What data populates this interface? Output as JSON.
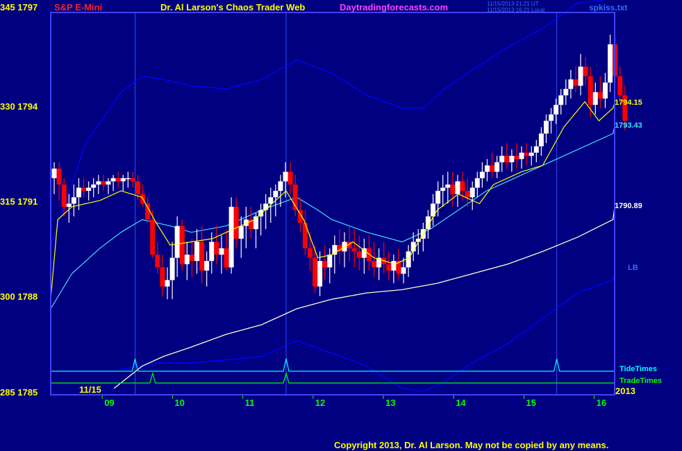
{
  "header": {
    "symbol": "S&P E-Mini",
    "title": "Dr. Al Larson's Chaos Trader Web",
    "site": "Daytradingforecasts.com",
    "timestamp_utc": "11/15/2013 21:21 UT",
    "timestamp_local": "11/15/2013 16:21 Local",
    "file": "spkiss.txt"
  },
  "footer": {
    "copyright": "Copyright 2013, Dr. Al Larson. May not be copied by any means."
  },
  "date_label": "11/15",
  "year_label": "2013",
  "colors": {
    "background": "#000080",
    "frame": "#4040ff",
    "up_bar": "#ffffff",
    "down_bar": "#ff0000",
    "fast_ma": "#ffff00",
    "mid_ma": "#40e0ff",
    "slow_ma": "#ffffd0",
    "band": "#0000ff",
    "tide": "#00ffff",
    "trade": "#00ff00",
    "axis_text": "#ffff00",
    "day_text": "#00ff00"
  },
  "chart_data": {
    "type": "ohlc",
    "left_axis": {
      "labels": [
        "345 1797",
        "330 1794",
        "315 1791",
        "300 1788",
        "285 1785"
      ],
      "values": [
        1797,
        1794,
        1791,
        1788,
        1785
      ],
      "range": [
        1785,
        1797
      ]
    },
    "x_axis": {
      "day_labels": [
        "09",
        "10",
        "11",
        "12",
        "13",
        "14",
        "15",
        "16"
      ]
    },
    "value_labels": [
      {
        "text": "1794.15",
        "series": "fast_ma",
        "value": 1794.15
      },
      {
        "text": "1793.43",
        "series": "mid_ma",
        "value": 1793.43
      },
      {
        "text": "1790.89",
        "series": "slow_ma",
        "value": 1790.89
      },
      {
        "text": "LB",
        "series": "lower_band",
        "value": 1788.8
      }
    ],
    "timing_lines": [
      {
        "name": "TideTimes",
        "peaks_day": [
          9.2,
          11.35,
          15.2
        ]
      },
      {
        "name": "TradeTimes",
        "peaks_day": [
          9.45,
          11.35
        ]
      }
    ],
    "vertical_markers_day": [
      9.2,
      11.35,
      15.2
    ],
    "series": {
      "upper_band": [
        [
          8.0,
          1789.7
        ],
        [
          8.5,
          1792.9
        ],
        [
          9.0,
          1794.5
        ],
        [
          9.3,
          1795.0
        ],
        [
          9.6,
          1794.9
        ],
        [
          10.0,
          1794.7
        ],
        [
          10.5,
          1794.6
        ],
        [
          11.0,
          1794.9
        ],
        [
          11.5,
          1795.5
        ],
        [
          12.0,
          1795.1
        ],
        [
          12.5,
          1794.4
        ],
        [
          13.0,
          1794.0
        ],
        [
          13.3,
          1794.0
        ],
        [
          13.6,
          1794.6
        ],
        [
          14.0,
          1795.2
        ],
        [
          14.5,
          1795.9
        ],
        [
          15.0,
          1796.5
        ],
        [
          15.5,
          1797.3
        ],
        [
          16.0,
          1798.2
        ]
      ],
      "lower_band": [
        [
          9.0,
          1785.8
        ],
        [
          9.5,
          1786.0
        ],
        [
          10.0,
          1786.0
        ],
        [
          10.5,
          1786.1
        ],
        [
          11.0,
          1786.2
        ],
        [
          11.5,
          1786.7
        ],
        [
          12.0,
          1786.3
        ],
        [
          12.5,
          1785.9
        ],
        [
          13.0,
          1785.2
        ],
        [
          13.3,
          1785.1
        ],
        [
          13.6,
          1785.4
        ],
        [
          14.0,
          1786.0
        ],
        [
          14.5,
          1786.6
        ],
        [
          15.0,
          1787.4
        ],
        [
          15.5,
          1788.2
        ],
        [
          16.0,
          1788.6
        ],
        [
          16.2,
          1788.8
        ]
      ],
      "slow_ma": [
        [
          8.9,
          1785.2
        ],
        [
          9.3,
          1785.9
        ],
        [
          9.6,
          1786.2
        ],
        [
          10.0,
          1786.5
        ],
        [
          10.5,
          1786.9
        ],
        [
          11.0,
          1787.2
        ],
        [
          11.5,
          1787.7
        ],
        [
          12.0,
          1788.0
        ],
        [
          12.5,
          1788.2
        ],
        [
          13.0,
          1788.3
        ],
        [
          13.5,
          1788.5
        ],
        [
          14.0,
          1788.8
        ],
        [
          14.5,
          1789.1
        ],
        [
          15.0,
          1789.5
        ],
        [
          15.5,
          1789.95
        ],
        [
          16.0,
          1790.5
        ],
        [
          16.2,
          1790.89
        ]
      ],
      "mid_ma": [
        [
          8.0,
          1787.7
        ],
        [
          8.3,
          1788.8
        ],
        [
          8.7,
          1789.6
        ],
        [
          9.0,
          1790.1
        ],
        [
          9.3,
          1790.5
        ],
        [
          9.7,
          1790.3
        ],
        [
          10.0,
          1790.1
        ],
        [
          10.5,
          1790.3
        ],
        [
          11.0,
          1790.8
        ],
        [
          11.5,
          1791.2
        ],
        [
          11.8,
          1790.8
        ],
        [
          12.0,
          1790.5
        ],
        [
          12.5,
          1790.1
        ],
        [
          13.0,
          1789.8
        ],
        [
          13.4,
          1790.2
        ],
        [
          13.8,
          1790.8
        ],
        [
          14.2,
          1791.4
        ],
        [
          14.6,
          1791.8
        ],
        [
          15.0,
          1792.2
        ],
        [
          15.5,
          1792.7
        ],
        [
          16.0,
          1793.2
        ],
        [
          16.2,
          1793.43
        ]
      ],
      "fast_ma": [
        [
          8.0,
          1788.0
        ],
        [
          8.1,
          1790.5
        ],
        [
          8.3,
          1790.9
        ],
        [
          8.7,
          1791.1
        ],
        [
          9.0,
          1791.4
        ],
        [
          9.3,
          1791.2
        ],
        [
          9.5,
          1790.4
        ],
        [
          9.7,
          1789.7
        ],
        [
          10.0,
          1789.8
        ],
        [
          10.3,
          1789.9
        ],
        [
          10.6,
          1790.2
        ],
        [
          10.9,
          1790.5
        ],
        [
          11.1,
          1790.9
        ],
        [
          11.35,
          1791.4
        ],
        [
          11.6,
          1790.5
        ],
        [
          11.8,
          1789.3
        ],
        [
          12.0,
          1789.4
        ],
        [
          12.3,
          1789.8
        ],
        [
          12.6,
          1789.3
        ],
        [
          12.9,
          1789.1
        ],
        [
          13.1,
          1789.3
        ],
        [
          13.5,
          1790.8
        ],
        [
          13.8,
          1791.3
        ],
        [
          14.1,
          1791.0
        ],
        [
          14.3,
          1791.6
        ],
        [
          14.7,
          1792.0
        ],
        [
          15.0,
          1792.2
        ],
        [
          15.3,
          1793.4
        ],
        [
          15.6,
          1794.2
        ],
        [
          15.8,
          1793.6
        ],
        [
          16.0,
          1794.0
        ],
        [
          16.2,
          1794.15
        ]
      ]
    },
    "bars": [
      [
        8.05,
        1791.8,
        1792.3,
        1791.3,
        1792.1
      ],
      [
        8.12,
        1792.1,
        1792.3,
        1791.1,
        1791.6
      ],
      [
        8.19,
        1791.6,
        1791.8,
        1790.6,
        1790.9
      ],
      [
        8.26,
        1790.9,
        1791.3,
        1790.4,
        1791.0
      ],
      [
        8.33,
        1791.0,
        1791.6,
        1790.6,
        1791.2
      ],
      [
        8.4,
        1791.2,
        1791.8,
        1790.8,
        1791.5
      ],
      [
        8.47,
        1791.5,
        1791.8,
        1791.2,
        1791.4
      ],
      [
        8.54,
        1791.4,
        1791.7,
        1791.1,
        1791.5
      ],
      [
        8.61,
        1791.5,
        1791.8,
        1791.2,
        1791.6
      ],
      [
        8.68,
        1791.6,
        1791.9,
        1791.3,
        1791.7
      ],
      [
        8.75,
        1791.7,
        1791.9,
        1791.4,
        1791.6
      ],
      [
        8.82,
        1791.6,
        1791.8,
        1791.3,
        1791.7
      ],
      [
        8.89,
        1791.7,
        1791.9,
        1791.4,
        1791.8
      ],
      [
        8.96,
        1791.8,
        1792.0,
        1791.5,
        1791.7
      ],
      [
        9.03,
        1791.7,
        1791.9,
        1791.4,
        1791.8
      ],
      [
        9.1,
        1791.8,
        1792.0,
        1791.5,
        1791.8
      ],
      [
        9.17,
        1791.8,
        1792.0,
        1791.5,
        1791.7
      ],
      [
        9.24,
        1791.7,
        1791.9,
        1791.1,
        1791.3
      ],
      [
        9.31,
        1791.3,
        1791.6,
        1790.9,
        1791.0
      ],
      [
        9.38,
        1791.0,
        1791.2,
        1790.4,
        1790.5
      ],
      [
        9.45,
        1790.5,
        1790.8,
        1789.3,
        1789.4
      ],
      [
        9.52,
        1789.4,
        1789.8,
        1788.8,
        1789.0
      ],
      [
        9.59,
        1789.0,
        1789.4,
        1788.1,
        1788.4
      ],
      [
        9.66,
        1788.4,
        1789.0,
        1788.0,
        1788.6
      ],
      [
        9.73,
        1788.6,
        1789.8,
        1788.0,
        1789.3
      ],
      [
        9.8,
        1789.3,
        1790.6,
        1788.7,
        1790.3
      ],
      [
        9.87,
        1790.3,
        1790.5,
        1788.9,
        1789.1
      ],
      [
        9.94,
        1789.1,
        1789.8,
        1788.6,
        1789.4
      ],
      [
        10.01,
        1789.4,
        1789.9,
        1788.7,
        1789.2
      ],
      [
        10.08,
        1789.2,
        1790.2,
        1788.8,
        1789.8
      ],
      [
        10.15,
        1789.8,
        1790.3,
        1788.5,
        1788.9
      ],
      [
        10.22,
        1788.9,
        1789.5,
        1788.4,
        1789.2
      ],
      [
        10.29,
        1789.2,
        1790.1,
        1788.8,
        1789.8
      ],
      [
        10.36,
        1789.8,
        1790.3,
        1789.1,
        1789.4
      ],
      [
        10.43,
        1789.4,
        1790.0,
        1788.8,
        1789.6
      ],
      [
        10.5,
        1789.6,
        1790.2,
        1788.9,
        1789.0
      ],
      [
        10.57,
        1789.0,
        1791.2,
        1788.8,
        1790.9
      ],
      [
        10.64,
        1790.9,
        1791.2,
        1789.6,
        1789.9
      ],
      [
        10.71,
        1789.9,
        1790.6,
        1789.3,
        1790.3
      ],
      [
        10.78,
        1790.3,
        1790.9,
        1789.6,
        1790.5
      ],
      [
        10.85,
        1790.5,
        1790.9,
        1789.9,
        1790.2
      ],
      [
        10.92,
        1790.2,
        1790.7,
        1789.6,
        1790.6
      ],
      [
        10.99,
        1790.6,
        1791.0,
        1790.0,
        1790.8
      ],
      [
        11.06,
        1790.8,
        1791.3,
        1790.2,
        1791.0
      ],
      [
        11.13,
        1791.0,
        1791.5,
        1790.4,
        1791.2
      ],
      [
        11.2,
        1791.2,
        1791.6,
        1790.6,
        1791.4
      ],
      [
        11.27,
        1791.4,
        1791.9,
        1790.9,
        1791.7
      ],
      [
        11.34,
        1791.7,
        1792.3,
        1791.2,
        1792.0
      ],
      [
        11.41,
        1792.0,
        1792.3,
        1791.3,
        1791.6
      ],
      [
        11.48,
        1791.6,
        1791.9,
        1790.6,
        1790.8
      ],
      [
        11.55,
        1790.8,
        1791.2,
        1790.1,
        1790.4
      ],
      [
        11.62,
        1790.4,
        1790.8,
        1789.4,
        1789.6
      ],
      [
        11.69,
        1789.6,
        1790.1,
        1788.9,
        1789.3
      ],
      [
        11.76,
        1789.3,
        1789.7,
        1788.2,
        1788.4
      ],
      [
        11.83,
        1788.4,
        1789.5,
        1788.1,
        1789.2
      ],
      [
        11.9,
        1789.2,
        1789.7,
        1788.6,
        1789.0
      ],
      [
        11.97,
        1789.0,
        1789.6,
        1788.5,
        1789.4
      ],
      [
        12.04,
        1789.4,
        1790.0,
        1788.8,
        1789.7
      ],
      [
        12.11,
        1789.7,
        1790.2,
        1789.1,
        1789.5
      ],
      [
        12.18,
        1789.5,
        1790.1,
        1789.0,
        1789.8
      ],
      [
        12.25,
        1789.8,
        1790.3,
        1789.2,
        1789.6
      ],
      [
        12.32,
        1789.6,
        1790.2,
        1789.0,
        1789.5
      ],
      [
        12.39,
        1789.5,
        1790.0,
        1788.9,
        1789.3
      ],
      [
        12.46,
        1789.3,
        1789.9,
        1788.8,
        1789.6
      ],
      [
        12.53,
        1789.6,
        1790.0,
        1788.9,
        1789.2
      ],
      [
        12.6,
        1789.2,
        1789.8,
        1788.7,
        1789.0
      ],
      [
        12.67,
        1789.0,
        1789.6,
        1788.6,
        1789.3
      ],
      [
        12.74,
        1789.3,
        1789.8,
        1788.8,
        1789.1
      ],
      [
        12.81,
        1789.1,
        1789.5,
        1788.6,
        1788.9
      ],
      [
        12.88,
        1788.9,
        1789.4,
        1788.5,
        1789.2
      ],
      [
        12.95,
        1789.2,
        1789.6,
        1788.6,
        1788.8
      ],
      [
        13.02,
        1788.8,
        1789.3,
        1788.5,
        1789.0
      ],
      [
        13.09,
        1789.0,
        1789.7,
        1788.7,
        1789.5
      ],
      [
        13.16,
        1789.5,
        1790.1,
        1789.2,
        1789.8
      ],
      [
        13.23,
        1789.8,
        1790.2,
        1789.4,
        1789.9
      ],
      [
        13.3,
        1789.9,
        1790.4,
        1789.5,
        1790.2
      ],
      [
        13.37,
        1790.2,
        1790.8,
        1789.9,
        1790.6
      ],
      [
        13.44,
        1790.6,
        1791.3,
        1790.3,
        1791.0
      ],
      [
        13.51,
        1791.0,
        1791.7,
        1790.6,
        1791.4
      ],
      [
        13.58,
        1791.4,
        1791.9,
        1790.9,
        1791.5
      ],
      [
        13.65,
        1791.5,
        1792.0,
        1791.0,
        1791.6
      ],
      [
        13.72,
        1791.6,
        1792.0,
        1790.9,
        1791.3
      ],
      [
        13.79,
        1791.3,
        1791.9,
        1790.9,
        1791.7
      ],
      [
        13.86,
        1791.7,
        1792.0,
        1791.1,
        1791.4
      ],
      [
        13.93,
        1791.4,
        1791.8,
        1790.9,
        1791.2
      ],
      [
        14.0,
        1791.2,
        1791.7,
        1790.8,
        1791.5
      ],
      [
        14.07,
        1791.5,
        1792.0,
        1791.2,
        1791.8
      ],
      [
        14.14,
        1791.8,
        1792.3,
        1791.5,
        1792.0
      ],
      [
        14.21,
        1792.0,
        1792.4,
        1791.7,
        1792.2
      ],
      [
        14.28,
        1792.2,
        1792.6,
        1791.8,
        1792.0
      ],
      [
        14.35,
        1792.0,
        1792.5,
        1791.8,
        1792.3
      ],
      [
        14.42,
        1792.3,
        1792.8,
        1792.0,
        1792.5
      ],
      [
        14.49,
        1792.5,
        1792.9,
        1792.1,
        1792.3
      ],
      [
        14.56,
        1792.3,
        1792.7,
        1792.0,
        1792.5
      ],
      [
        14.63,
        1792.5,
        1792.9,
        1792.1,
        1792.4
      ],
      [
        14.7,
        1792.4,
        1792.8,
        1792.1,
        1792.6
      ],
      [
        14.77,
        1792.6,
        1792.9,
        1792.2,
        1792.5
      ],
      [
        14.84,
        1792.5,
        1792.8,
        1792.2,
        1792.6
      ],
      [
        14.91,
        1792.6,
        1793.0,
        1792.3,
        1792.8
      ],
      [
        14.98,
        1792.8,
        1793.4,
        1792.5,
        1793.2
      ],
      [
        15.05,
        1793.2,
        1793.8,
        1792.9,
        1793.6
      ],
      [
        15.12,
        1793.6,
        1794.0,
        1793.2,
        1793.8
      ],
      [
        15.19,
        1793.8,
        1794.3,
        1793.5,
        1794.1
      ],
      [
        15.26,
        1794.1,
        1794.6,
        1793.8,
        1794.4
      ],
      [
        15.33,
        1794.4,
        1794.9,
        1794.1,
        1794.6
      ],
      [
        15.4,
        1794.6,
        1795.2,
        1794.3,
        1794.9
      ],
      [
        15.47,
        1794.9,
        1795.3,
        1794.5,
        1794.7
      ],
      [
        15.54,
        1794.7,
        1795.7,
        1794.4,
        1795.3
      ],
      [
        15.61,
        1795.3,
        1795.6,
        1794.7,
        1795.0
      ],
      [
        15.68,
        1795.0,
        1795.3,
        1793.7,
        1794.1
      ],
      [
        15.75,
        1794.1,
        1794.8,
        1793.8,
        1794.5
      ],
      [
        15.82,
        1794.5,
        1795.0,
        1794.0,
        1794.3
      ],
      [
        15.89,
        1794.3,
        1795.1,
        1794.0,
        1794.8
      ],
      [
        15.96,
        1794.8,
        1796.3,
        1794.5,
        1796.0
      ],
      [
        16.03,
        1796.0,
        1796.2,
        1794.8,
        1795.0
      ],
      [
        16.1,
        1795.0,
        1795.3,
        1794.2,
        1794.4
      ],
      [
        16.17,
        1794.4,
        1794.7,
        1793.3,
        1793.6
      ]
    ]
  }
}
